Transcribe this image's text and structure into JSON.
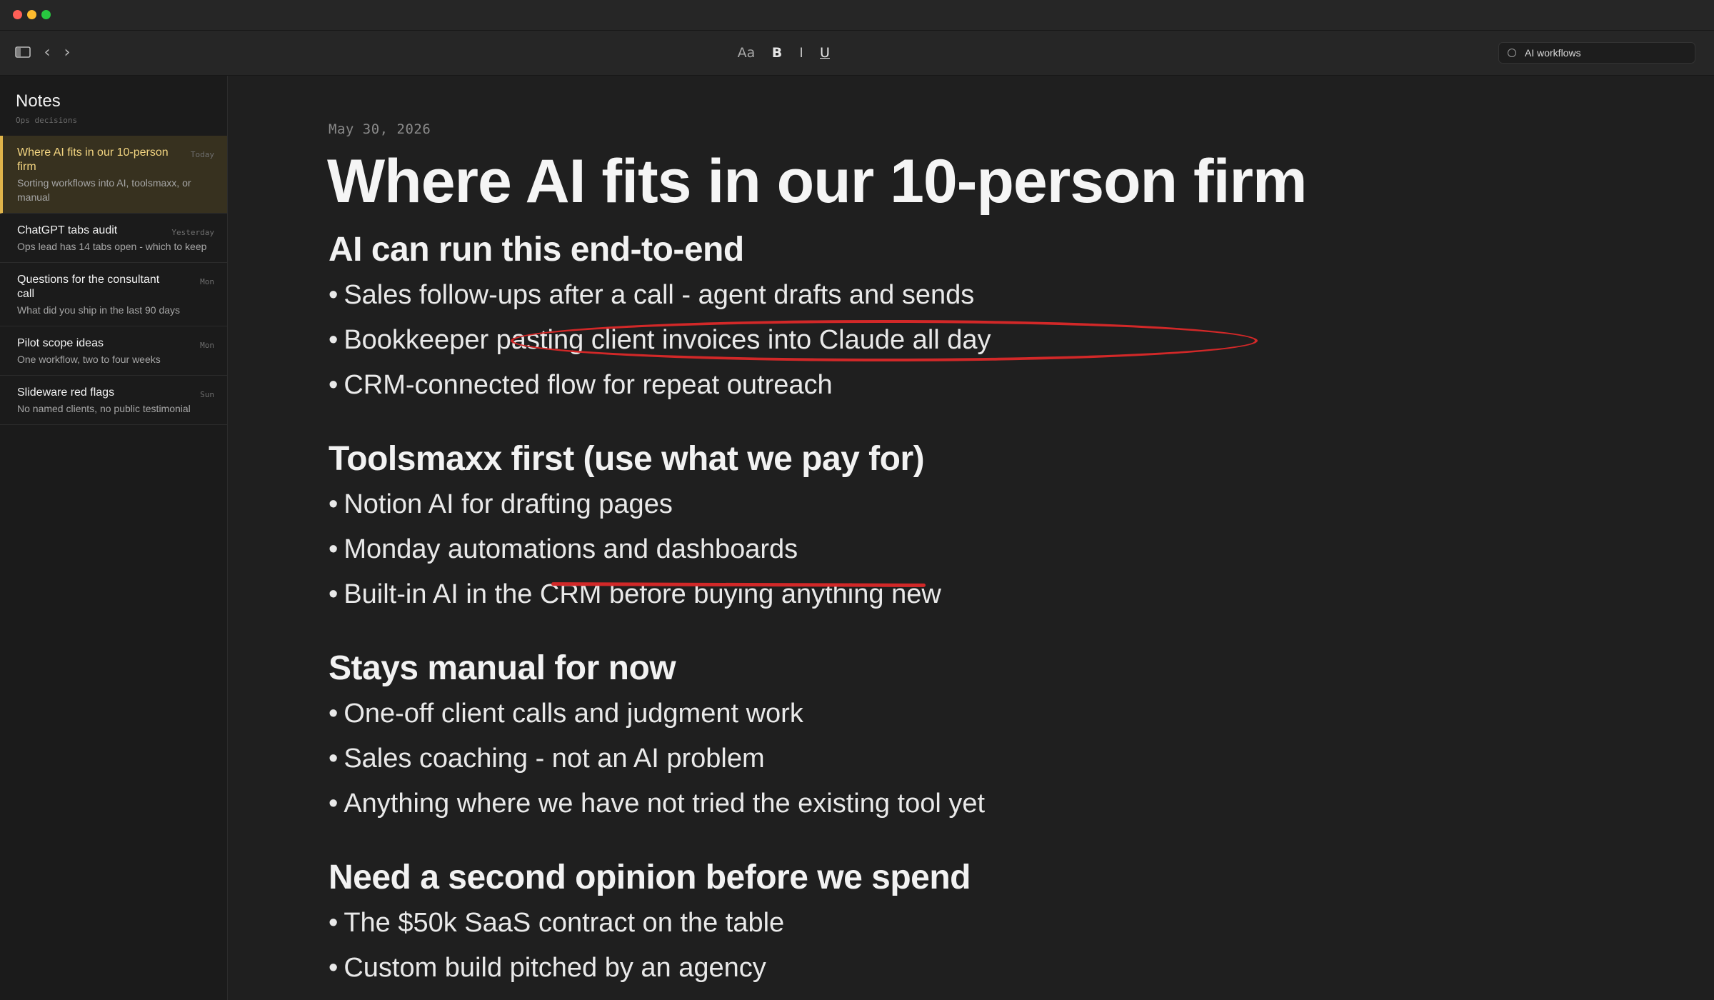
{
  "toolbar": {
    "format_case_label": "Aa",
    "bold_label": "B",
    "italic_label": "I",
    "underline_label": "U",
    "search_value": "AI workflows"
  },
  "sidebar": {
    "title": "Notes",
    "subtitle": "Ops decisions",
    "notes": [
      {
        "title": "Where AI fits in our 10-person firm",
        "date": "Today",
        "preview": "Sorting workflows into AI, toolsmaxx, or manual",
        "active": true
      },
      {
        "title": "ChatGPT tabs audit",
        "date": "Yesterday",
        "preview": "Ops lead has 14 tabs open - which to keep",
        "active": false
      },
      {
        "title": "Questions for the consultant call",
        "date": "Mon",
        "preview": "What did you ship in the last 90 days",
        "active": false
      },
      {
        "title": "Pilot scope ideas",
        "date": "Mon",
        "preview": "One workflow, two to four weeks",
        "active": false
      },
      {
        "title": "Slideware red flags",
        "date": "Sun",
        "preview": "No named clients, no public testimonial",
        "active": false
      }
    ]
  },
  "editor": {
    "date": "May 30, 2026",
    "title": "Where AI fits in our 10-person firm",
    "bullet_char": "•",
    "sections": [
      {
        "heading": "AI can run this end-to-end",
        "items": [
          "Sales follow-ups after a call - agent drafts and sends",
          "Bookkeeper pasting client invoices into Claude all day",
          "CRM-connected flow for repeat outreach"
        ]
      },
      {
        "heading": "Toolsmaxx first (use what we pay for)",
        "items": [
          "Notion AI for drafting pages",
          "Monday automations and dashboards",
          "Built-in AI in the CRM before buying anything new"
        ]
      },
      {
        "heading": "Stays manual for now",
        "items": [
          "One-off client calls and judgment work",
          "Sales coaching - not an AI problem",
          "Anything where we have not tried the existing tool yet"
        ]
      },
      {
        "heading": "Need a second opinion before we spend",
        "items": [
          "The $50k SaaS contract on the table",
          "Custom build pitched by an agency"
        ]
      }
    ]
  },
  "annotations": {
    "color": "#d22828",
    "circled_item": "Bookkeeper pasting client invoices into Claude all day",
    "underlined_item": "Notion AI for drafting pages"
  },
  "colors": {
    "accent": "#e0b44a",
    "active_note_bg": "#37311f",
    "background": "#1f1f1f"
  }
}
